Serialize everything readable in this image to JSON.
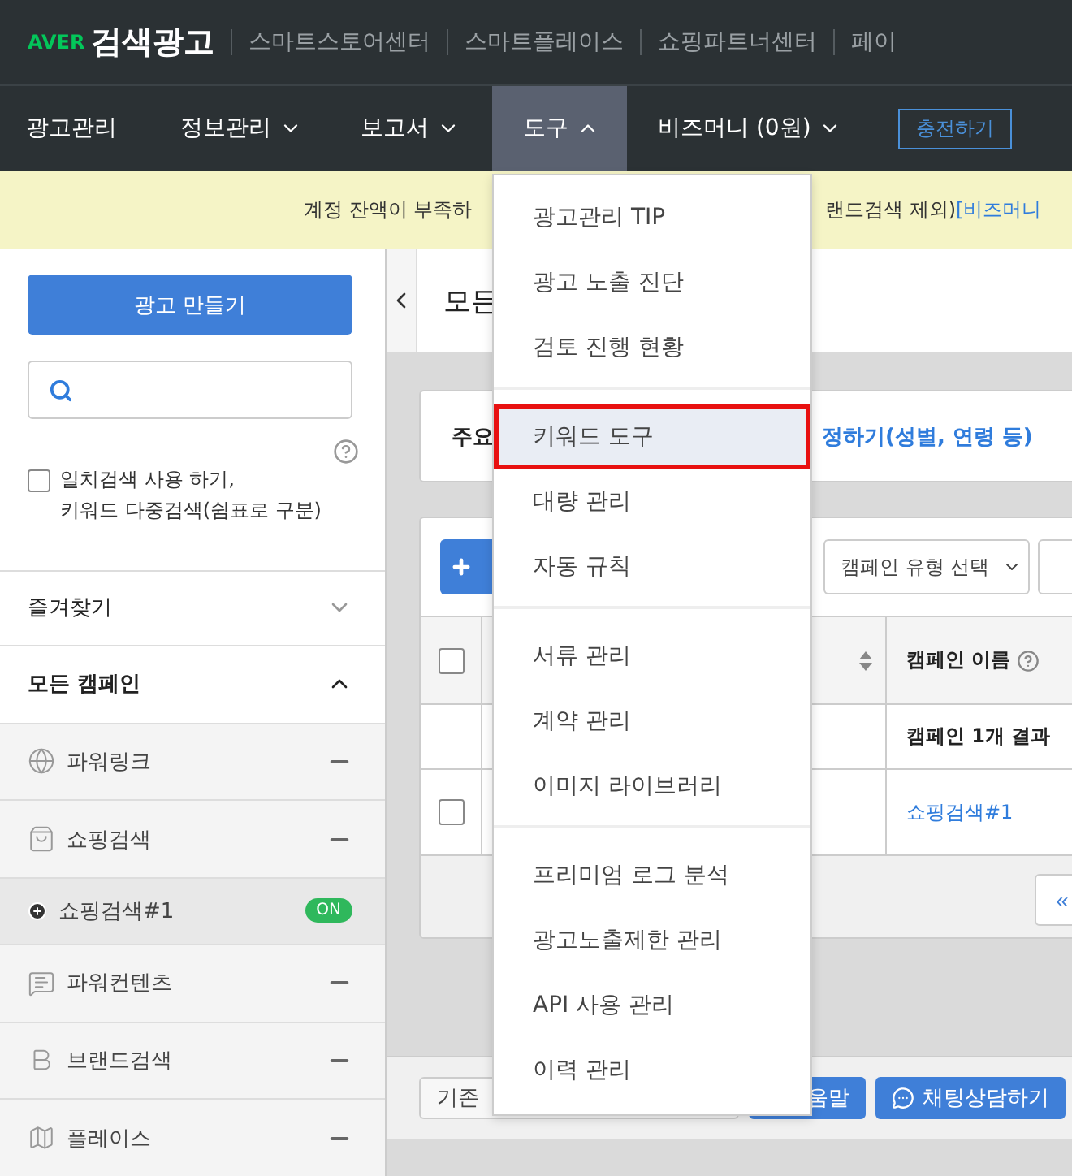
{
  "top_bar": {
    "logo_mark": "AVER",
    "logo_text": "검색광고",
    "links": [
      "스마트스토어센터",
      "스마트플레이스",
      "쇼핑파트너센터",
      "페이"
    ]
  },
  "nav": {
    "items": [
      {
        "label": "광고관리",
        "kind": "plain",
        "selected": false
      },
      {
        "label": "정보관리",
        "kind": "menu",
        "expanded": false,
        "selected": false
      },
      {
        "label": "보고서",
        "kind": "menu",
        "expanded": false,
        "selected": false
      },
      {
        "label": "도구",
        "kind": "menu",
        "expanded": true,
        "selected": true
      },
      {
        "label": "비즈머니 (0원)",
        "kind": "menu",
        "expanded": false,
        "selected": false
      }
    ],
    "charge_button": "충전하기"
  },
  "banner": {
    "text_left": "계정 잔액이 부족하",
    "text_right": "랜드검색 제외)",
    "link": "[비즈머니"
  },
  "sidebar": {
    "create_button": "광고 만들기",
    "exact_search": {
      "checked": false,
      "label": "일치검색 사용 하기,\n키워드 다중검색(쉼표로 구분)"
    },
    "sections": [
      {
        "label": "즐겨찾기",
        "expanded": false
      },
      {
        "label": "모든 캠페인",
        "expanded": true
      }
    ],
    "campaigns": [
      {
        "label": "파워링크",
        "kind": "type",
        "selected": false
      },
      {
        "label": "쇼핑검색",
        "kind": "type",
        "selected": false
      },
      {
        "label": "쇼핑검색#1",
        "kind": "campaign",
        "status": "ON",
        "selected": true
      },
      {
        "label": "파워컨텐츠",
        "kind": "type",
        "selected": false
      },
      {
        "label": "브랜드검색",
        "kind": "type",
        "selected": false
      },
      {
        "label": "플레이스",
        "kind": "type",
        "selected": false
      }
    ]
  },
  "main": {
    "title": "모든",
    "info_card": {
      "label": "주요",
      "link": "정하기(성별, 연령 등)"
    },
    "toolbar": {
      "filter": "캠페인 유형 선택"
    },
    "table": {
      "header_checked": false,
      "column_3": "캠페인 이름",
      "summary": "캠페인 1개 결과",
      "rows": [
        {
          "checked": false,
          "name": "쇼핑검색#1"
        }
      ]
    },
    "pager": "«"
  },
  "footer": {
    "buttons": [
      {
        "label": "기존",
        "kind": "outline"
      },
      {
        "label": "움말",
        "kind": "primary"
      },
      {
        "label": "채팅상담하기",
        "kind": "chat"
      }
    ]
  },
  "tools_menu": {
    "groups": [
      [
        {
          "label": "광고관리 TIP",
          "selected": false
        },
        {
          "label": "광고 노출 진단",
          "selected": false
        },
        {
          "label": "검토 진행 현황",
          "selected": false
        }
      ],
      [
        {
          "label": "키워드 도구",
          "selected": true
        },
        {
          "label": "대량 관리",
          "selected": false
        },
        {
          "label": "자동 규칙",
          "selected": false
        }
      ],
      [
        {
          "label": "서류 관리",
          "selected": false
        },
        {
          "label": "계약 관리",
          "selected": false
        },
        {
          "label": "이미지 라이브러리",
          "selected": false
        }
      ],
      [
        {
          "label": "프리미엄 로그 분석",
          "selected": false
        },
        {
          "label": "광고노출제한 관리",
          "selected": false
        },
        {
          "label": "API 사용 관리",
          "selected": false
        },
        {
          "label": "이력 관리",
          "selected": false
        }
      ]
    ]
  }
}
